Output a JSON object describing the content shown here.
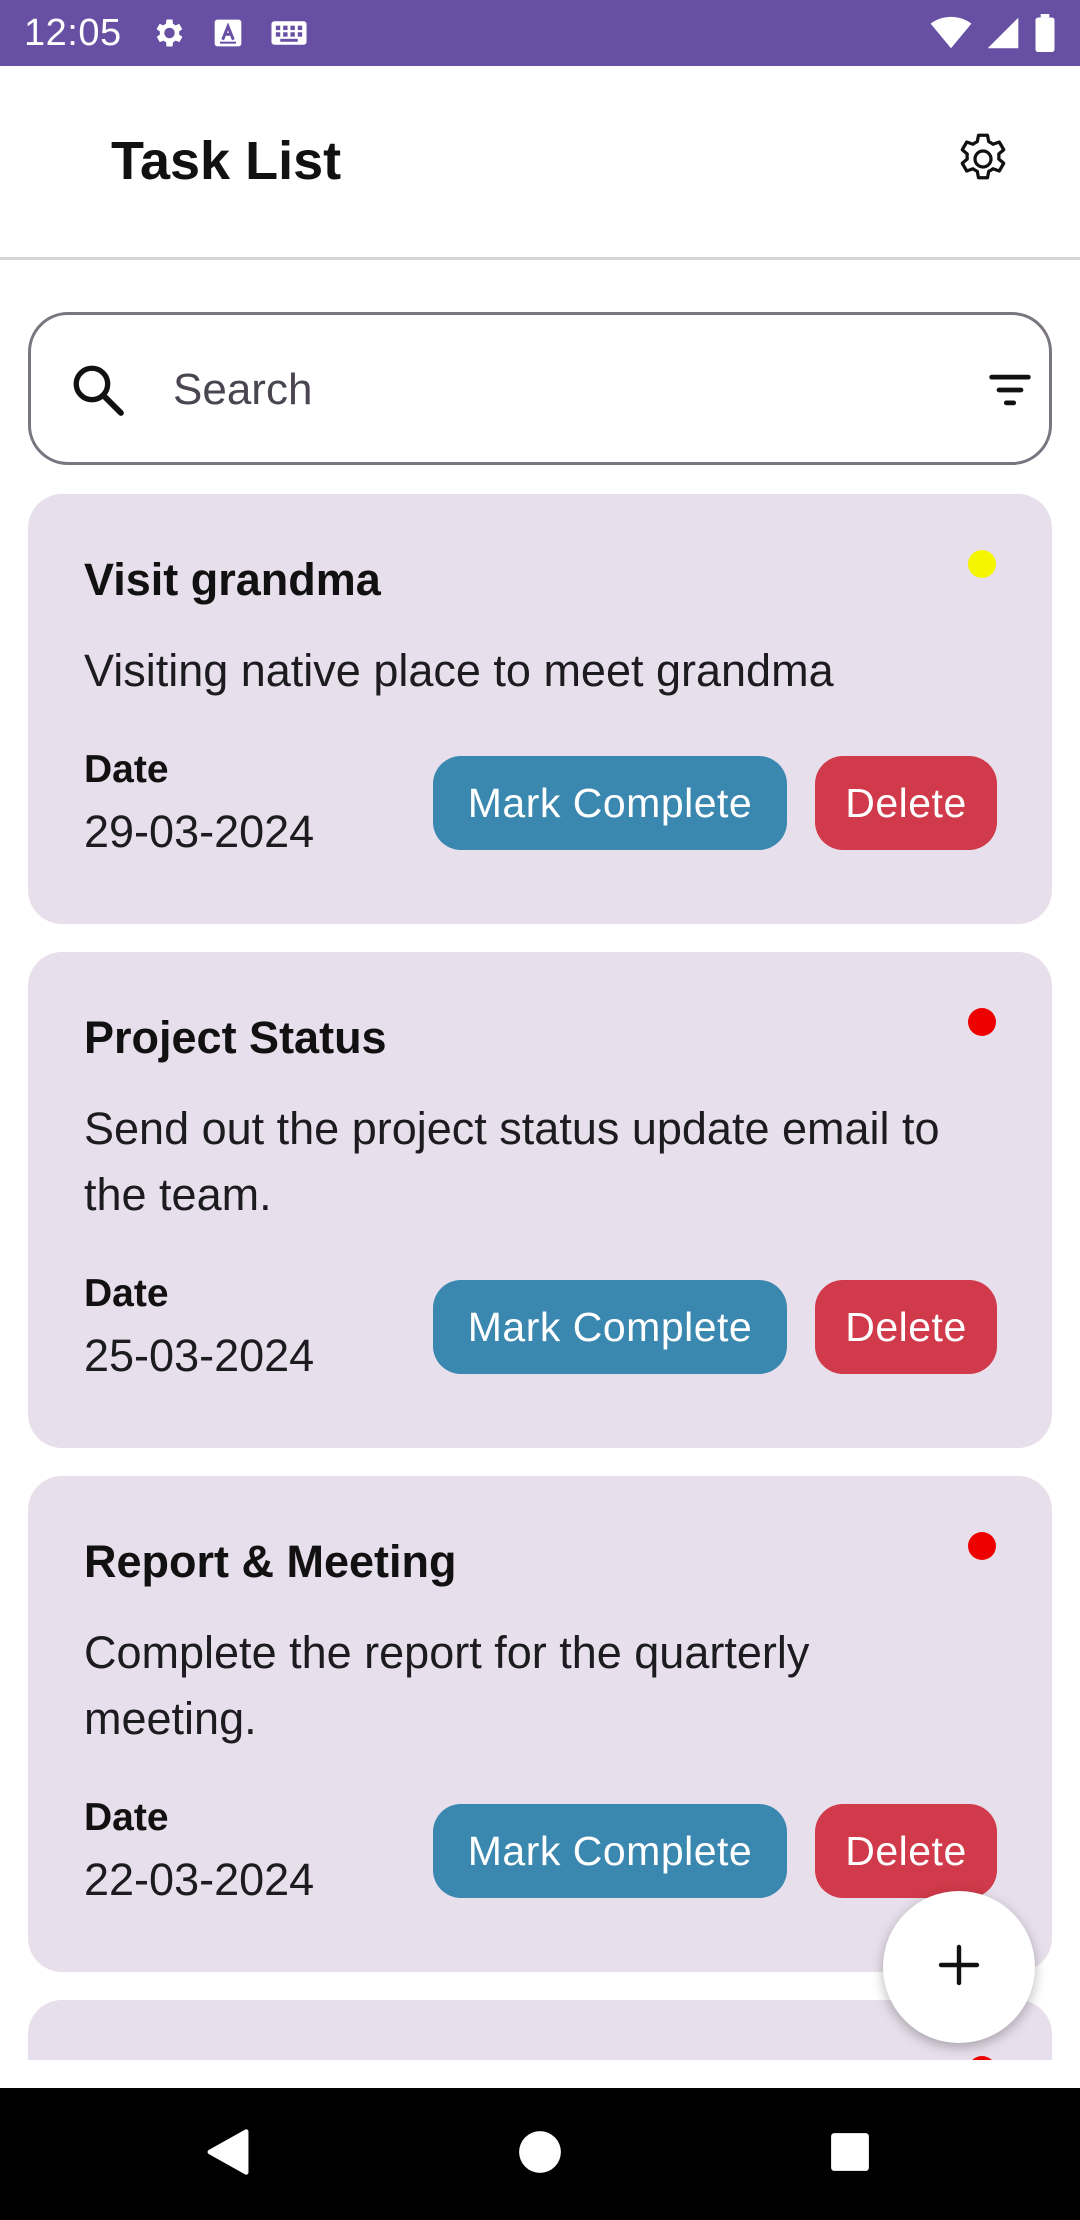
{
  "status_bar": {
    "time": "12:05",
    "left_icons": [
      "gear-icon",
      "keyboard-a-icon",
      "keyboard-icon"
    ],
    "right_icons": [
      "wifi-icon",
      "signal-icon",
      "battery-icon"
    ],
    "background": "#6750a4"
  },
  "header": {
    "title": "Task List",
    "settings_icon": "gear-icon"
  },
  "search": {
    "placeholder": "Search",
    "value": "",
    "search_icon": "search-icon",
    "filter_icon": "filter-icon"
  },
  "tasks": [
    {
      "title": "Visit grandma",
      "description": "Visiting native place to meet grandma",
      "date_label": "Date",
      "date": "29-03-2024",
      "priority_color": "#f5f500",
      "complete_label": "Mark Complete",
      "delete_label": "Delete"
    },
    {
      "title": "Project Status",
      "description": "Send out the project status update email to the team.",
      "date_label": "Date",
      "date": "25-03-2024",
      "priority_color": "#ee0000",
      "complete_label": "Mark Complete",
      "delete_label": "Delete"
    },
    {
      "title": "Report & Meeting",
      "description": "Complete the report for the quarterly meeting.",
      "date_label": "Date",
      "date": "22-03-2024",
      "priority_color": "#ee0000",
      "complete_label": "Mark Complete",
      "delete_label": "Delete"
    },
    {
      "priority_color": "#ee0000"
    }
  ],
  "fab": {
    "icon": "plus-icon"
  },
  "nav_bar": {
    "buttons": [
      "back-icon",
      "home-icon",
      "recents-icon"
    ]
  },
  "colors": {
    "card_background": "#e7dfeb",
    "complete_button": "#3a87b0",
    "delete_button": "#d13a4a"
  }
}
